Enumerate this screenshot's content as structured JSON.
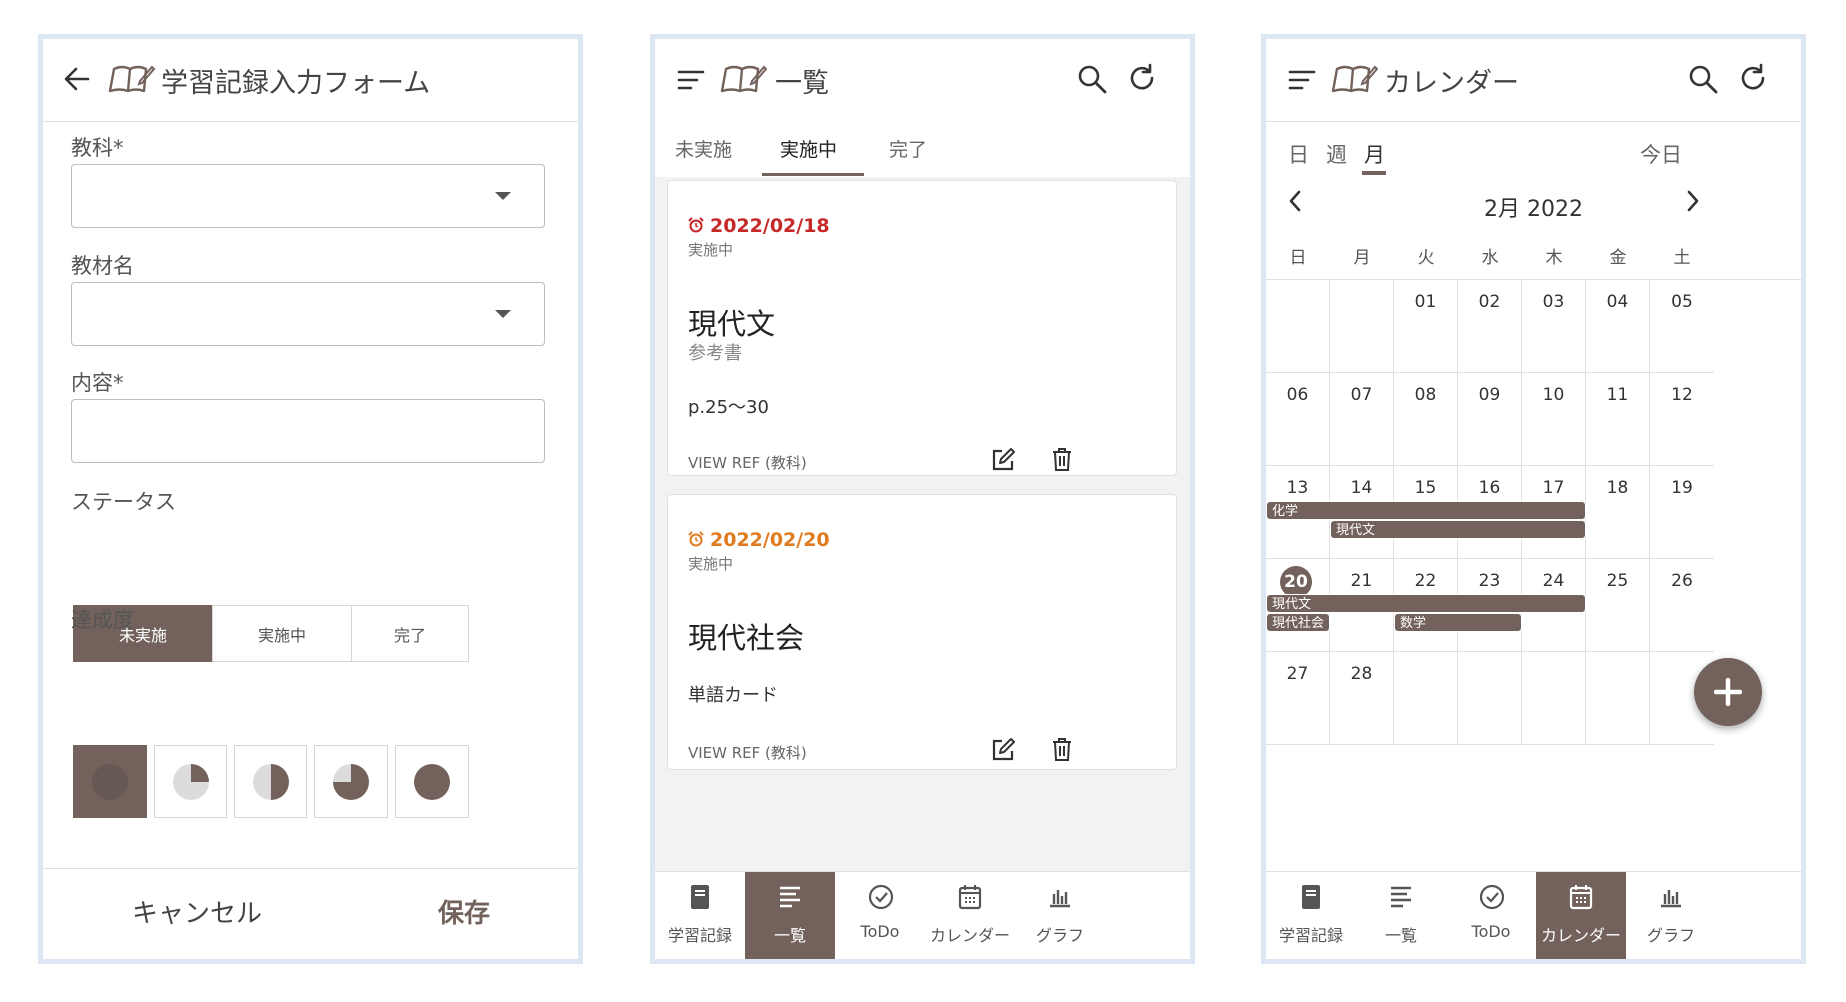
{
  "theme": {
    "accent": "#73625b",
    "date_overdue": "#c62828",
    "date_upcoming": "#e07b1f",
    "frame": "#dde6f3"
  },
  "form": {
    "title": "学習記録入力フォーム",
    "subject_label": "教科*",
    "subject_value": "",
    "material_label": "教材名",
    "material_value": "",
    "content_label": "内容*",
    "content_value": "",
    "status_label": "ステータス",
    "status_options": [
      "未実施",
      "実施中",
      "完了"
    ],
    "status_selected": "未実施",
    "achievement_label": "達成度",
    "achievement_levels": [
      0,
      0.25,
      0.5,
      0.75,
      1
    ],
    "achievement_selected": 0,
    "cancel_label": "キャンセル",
    "save_label": "保存"
  },
  "list": {
    "title": "一覧",
    "tabs": [
      "未実施",
      "実施中",
      "完了"
    ],
    "active_tab": "実施中",
    "cards": [
      {
        "date": "2022/02/18",
        "status": "実施中",
        "subject": "現代文",
        "material": "参考書",
        "content": "p.25〜30",
        "ref": "VIEW REF (教科)"
      },
      {
        "date": "2022/02/20",
        "status": "実施中",
        "subject": "現代社会",
        "material": "",
        "content": "単語カード",
        "ref": "VIEW REF (教科)"
      }
    ]
  },
  "nav": {
    "items": [
      "学習記録",
      "一覧",
      "ToDo",
      "カレンダー",
      "グラフ"
    ]
  },
  "calendar": {
    "title": "カレンダー",
    "view_tabs": [
      "日",
      "週",
      "月"
    ],
    "active_view": "月",
    "today_label": "今日",
    "month_label": "2月 2022",
    "weekdays": [
      "日",
      "月",
      "火",
      "水",
      "木",
      "金",
      "土"
    ],
    "weeks": [
      [
        "",
        "",
        "01",
        "02",
        "03",
        "04",
        "05"
      ],
      [
        "06",
        "07",
        "08",
        "09",
        "10",
        "11",
        "12"
      ],
      [
        "13",
        "14",
        "15",
        "16",
        "17",
        "18",
        "19"
      ],
      [
        "20",
        "21",
        "22",
        "23",
        "24",
        "25",
        "26"
      ],
      [
        "27",
        "28",
        "",
        "",
        "",
        "",
        ""
      ]
    ],
    "today": "20",
    "events": [
      {
        "label": "化学",
        "start": "13",
        "end": "17"
      },
      {
        "label": "現代文",
        "start": "14",
        "end": "17"
      },
      {
        "label": "現代文",
        "start": "20",
        "end": "24"
      },
      {
        "label": "現代社会",
        "start": "20",
        "end": "20"
      },
      {
        "label": "数学",
        "start": "22",
        "end": "23"
      }
    ]
  }
}
